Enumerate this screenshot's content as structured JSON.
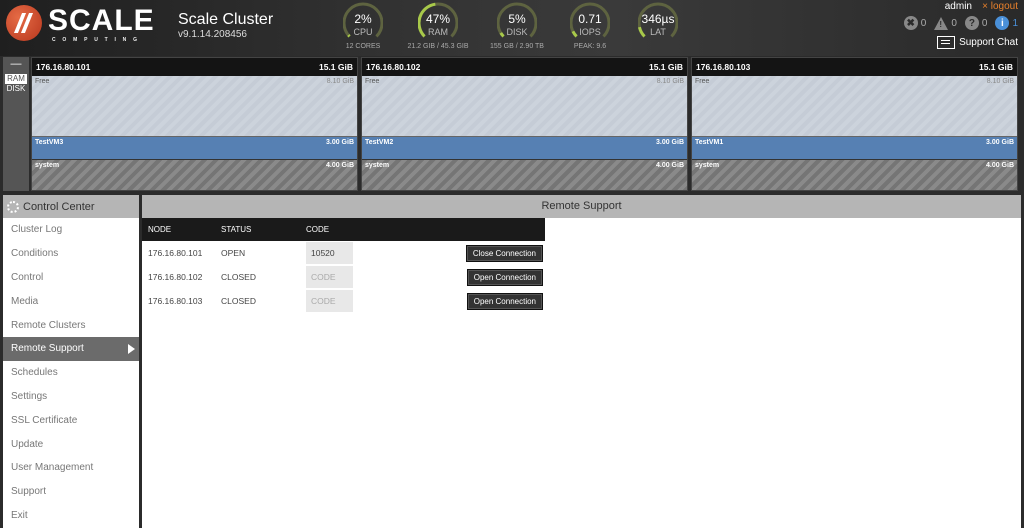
{
  "app": {
    "brand": "SCALE",
    "brand_sub": "COMPUTING",
    "title": "Scale Cluster",
    "version": "v9.1.14.208456"
  },
  "gauges": [
    {
      "value": "2%",
      "label": "CPU",
      "sub": "12 CORES",
      "fraction": 0.02
    },
    {
      "value": "47%",
      "label": "RAM",
      "sub": "21.2 GIB / 45.3 GIB",
      "fraction": 0.47
    },
    {
      "value": "5%",
      "label": "DISK",
      "sub": "155 GB / 2.90 TB",
      "fraction": 0.05
    },
    {
      "value": "0.71",
      "label": "IOPS",
      "sub": "PEAK: 9.6",
      "fraction": 0.07
    },
    {
      "value": "346µs",
      "label": "LAT",
      "sub": "",
      "fraction": 0.12
    }
  ],
  "user": {
    "name": "admin",
    "logout": "× logout",
    "alerts": [
      {
        "type": "error",
        "icon": "✖",
        "count": "0"
      },
      {
        "type": "warning",
        "icon": "!",
        "count": "0"
      },
      {
        "type": "question",
        "icon": "?",
        "count": "0"
      },
      {
        "type": "info",
        "icon": "i",
        "count": "1"
      }
    ],
    "support_chat": "Support Chat"
  },
  "view_toggle": {
    "collapse": "—",
    "ram": "RAM",
    "disk": "DISK",
    "active": "RAM"
  },
  "nodes": [
    {
      "ip": "176.16.80.101",
      "total": "15.1 GiB",
      "free_label": "Free",
      "free": "8.10 GiB",
      "vm": "TestVM3",
      "vm_size": "3.00 GiB",
      "sys_label": "system",
      "sys": "4.00 GiB"
    },
    {
      "ip": "176.16.80.102",
      "total": "15.1 GiB",
      "free_label": "Free",
      "free": "8.10 GiB",
      "vm": "TestVM2",
      "vm_size": "3.00 GiB",
      "sys_label": "system",
      "sys": "4.00 GiB"
    },
    {
      "ip": "176.16.80.103",
      "total": "15.1 GiB",
      "free_label": "Free",
      "free": "8.10 GiB",
      "vm": "TestVM1",
      "vm_size": "3.00 GiB",
      "sys_label": "system",
      "sys": "4.00 GiB"
    }
  ],
  "sidebar": {
    "title": "Control Center",
    "items": [
      {
        "label": "Cluster Log"
      },
      {
        "label": "Conditions"
      },
      {
        "label": "Control"
      },
      {
        "label": "Media"
      },
      {
        "label": "Remote Clusters"
      },
      {
        "label": "Remote Support",
        "active": true
      },
      {
        "label": "Schedules"
      },
      {
        "label": "Settings"
      },
      {
        "label": "SSL Certificate"
      },
      {
        "label": "Update"
      },
      {
        "label": "User Management"
      },
      {
        "label": "Support"
      },
      {
        "label": "Exit"
      }
    ]
  },
  "main": {
    "title": "Remote Support",
    "columns": [
      "NODE",
      "STATUS",
      "CODE"
    ],
    "rows": [
      {
        "node": "176.16.80.101",
        "status": "OPEN",
        "code": "10520",
        "code_placeholder": "CODE",
        "action": "Close Connection"
      },
      {
        "node": "176.16.80.102",
        "status": "CLOSED",
        "code": "",
        "code_placeholder": "CODE",
        "action": "Open Connection"
      },
      {
        "node": "176.16.80.103",
        "status": "CLOSED",
        "code": "",
        "code_placeholder": "CODE",
        "action": "Open Connection"
      }
    ]
  },
  "colors": {
    "accent_orange": "#e8812c",
    "gauge_track": "#5e6340",
    "gauge_fill": "#a8c94a",
    "vm_blue": "#5680b3",
    "info_blue": "#4a90d9"
  }
}
